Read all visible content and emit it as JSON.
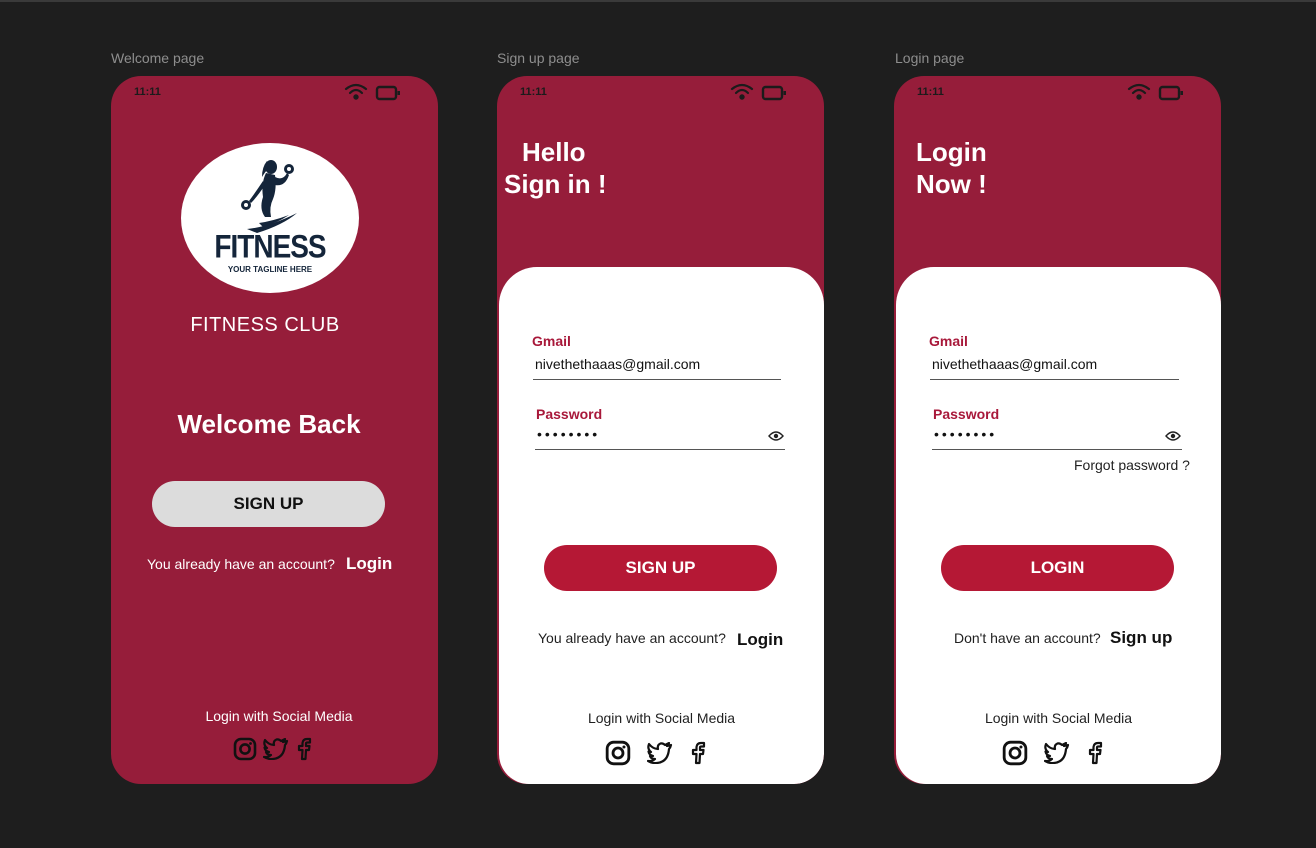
{
  "welcome_frame": {
    "label": "Welcome page",
    "time": "11:11",
    "logo_text": "FITNESS",
    "logo_tagline": "YOUR TAGLINE HERE",
    "club_name": "FITNESS CLUB",
    "heading": "Welcome Back",
    "signup_button": "SIGN UP",
    "account_prompt": "You already have an account?",
    "login_link": "Login",
    "social_label": "Login with Social Media"
  },
  "signup_frame": {
    "label": "Sign up page",
    "time": "11:11",
    "heading_line1": "Hello",
    "heading_line2": "Sign in !",
    "gmail_label": "Gmail",
    "gmail_value": "nivethethaaas@gmail.com",
    "password_label": "Password",
    "password_value": "••••••••",
    "signup_button": "SIGN UP",
    "account_prompt": "You already have an account?",
    "login_link": "Login",
    "social_label": "Login with Social Media"
  },
  "login_frame": {
    "label": "Login page",
    "time": "11:11",
    "heading_line1": "Login",
    "heading_line2": "Now !",
    "gmail_label": "Gmail",
    "gmail_value": "nivethethaaas@gmail.com",
    "password_label": "Password",
    "password_value": "••••••••",
    "forgot_link": "Forgot password ?",
    "login_button": "LOGIN",
    "account_prompt": "Don't have an account?",
    "signup_link": "Sign up",
    "social_label": "Login with Social Media"
  },
  "colors": {
    "background": "#1e1e1e",
    "brand": "#961d3a",
    "accent": "#b51835",
    "card": "#ffffff"
  },
  "icons": [
    "wifi-icon",
    "battery-icon",
    "instagram-icon",
    "twitter-icon",
    "facebook-icon",
    "eye-icon"
  ]
}
